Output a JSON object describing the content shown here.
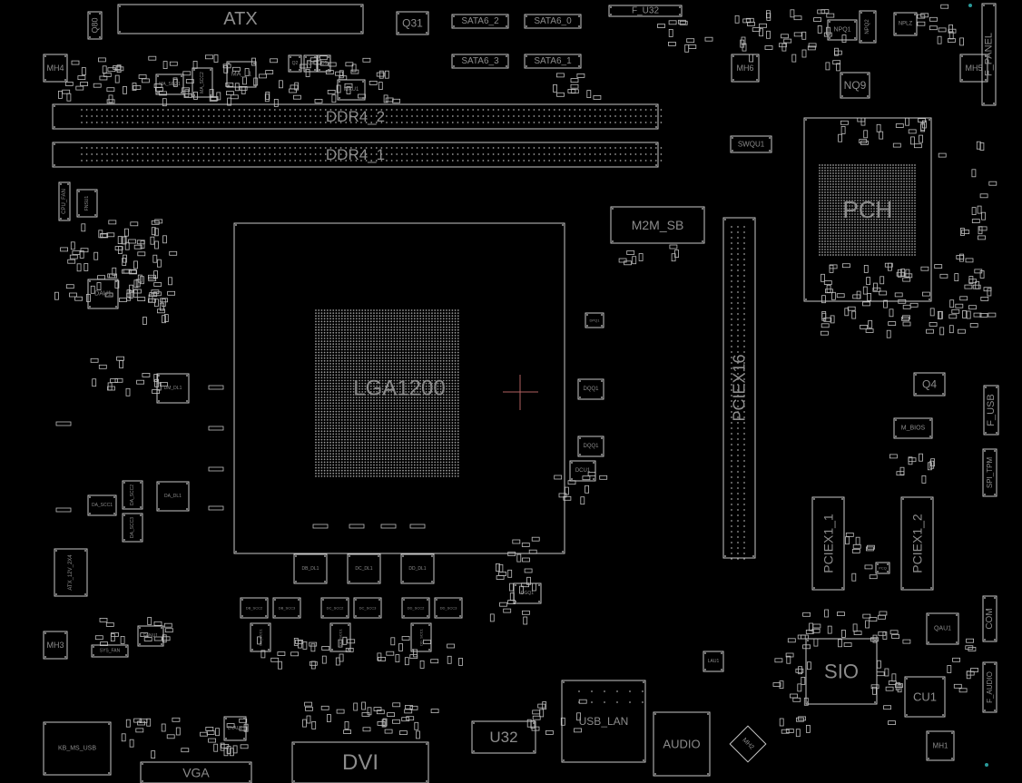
{
  "view": {
    "background": "#000000",
    "outline_color": "#c8c8c8",
    "label_color": "#8c8c8c",
    "cursor_color": "#b06060",
    "marker_color": "#2a9a9a"
  },
  "components": {
    "atx": "ATX",
    "q80": "Q80",
    "q31": "Q31",
    "sata6_2": "SATA6_2",
    "sata6_0": "SATA6_0",
    "sata6_3": "SATA6_3",
    "sata6_1": "SATA6_1",
    "f_u32": "F_U32",
    "mh4": "MH4",
    "ma_l1": "MA_L1",
    "ma_scc1": "MA_SCC1",
    "ma_scc2": "MA_SCC2",
    "mau1": "MAU1",
    "q2": "Q2",
    "q3": "Q3",
    "q5": "Q5",
    "ddr4_2": "DDR4_2",
    "ddr4_1": "DDR4_1",
    "mh6": "MH6",
    "npq1": "NPQ1",
    "npq2": "NPQ2",
    "nplz": "NPLZ",
    "nq9": "NQ9",
    "mh5": "MH5",
    "f_panel": "F_PANEL",
    "swqu1": "SWQU1",
    "pch": "PCH",
    "m2m_sb": "M2M_SB",
    "pciex16": "PCIEX16",
    "cpu_fan": "CPU_FAN",
    "fnsu1": "FNSU1",
    "dau1": "DAU1",
    "dm_dl1": "DM_DL1",
    "da_dl1": "DA_DL1",
    "da_scc1": "DA_SCC1",
    "da_scc2": "DA_SCC2",
    "da_scc3": "DA_SCC3",
    "lga1200": "LGA1200",
    "db_dl1": "DB_DL1",
    "dc_dl1": "DC_DL1",
    "dd_dl1": "DD_DL1",
    "db_scc2": "DB_SCC2",
    "db_scc3": "DB_SCC3",
    "dc_scc2": "DC_SCC2",
    "dc_scc3": "DC_SCC3",
    "dd_scc2": "DD_SCC2",
    "dd_scc3": "DD_SCC3",
    "db_scc1": "DB_SCC1",
    "dc_scc1": "DC_SCC1",
    "dd_scc1": "DD_SCC1",
    "dpq1": "DPQ1",
    "dqq1_a": "DQQ1",
    "dqq1_b": "DQQ1",
    "dcu1": "DCU1",
    "dgq1": "DGQ1",
    "atx_12v_2x4": "ATX_12V_2X4",
    "mh3": "MH3",
    "sys_fan": "SYS_FAN",
    "fanu1": "FANU1",
    "kb_ms_usb": "KB_MS_USB",
    "vga": "VGA",
    "dvau1": "DVAU1",
    "dvi": "DVI",
    "u32": "U32",
    "usb_lan": "USB_LAN",
    "audio": "AUDIO",
    "mh2": "MH2",
    "lau1": "LAU1",
    "sio": "SIO",
    "cu1": "CU1",
    "qau1": "QAU1",
    "com": "COM",
    "f_audio": "F_AUDIO",
    "mh1": "MH1",
    "q4": "Q4",
    "m_bios": "M_BIOS",
    "f_usb": "F_USB",
    "spi_tpm": "SPI_TPM",
    "pciex1_1": "PCIEX1_1",
    "pciex1_2": "PCIEX1_2",
    "pcq": "PCQ"
  }
}
